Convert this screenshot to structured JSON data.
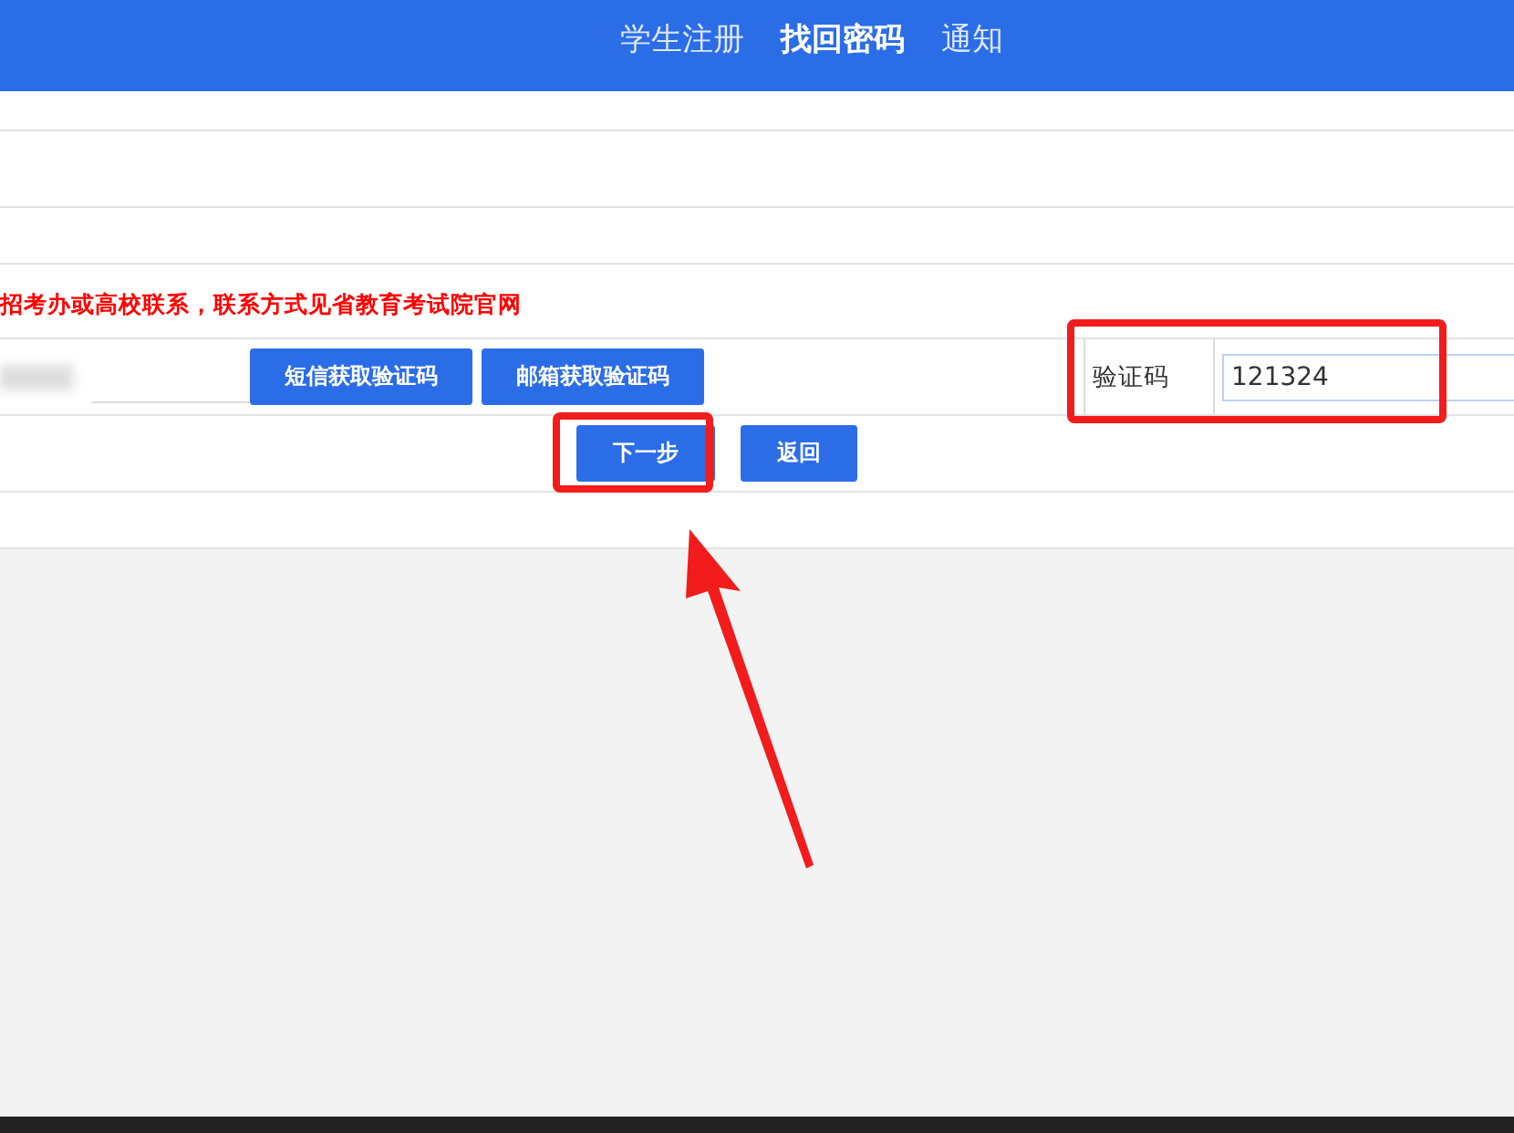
{
  "tabs": [
    {
      "label": "学生注册",
      "selected": false
    },
    {
      "label": "找回密码",
      "selected": true
    },
    {
      "label": "通知",
      "selected": false
    }
  ],
  "notice": "招考办或高校联系，联系方式见省教育考试院官网",
  "code_buttons": [
    {
      "label": "短信获取验证码"
    },
    {
      "label": "邮箱获取验证码"
    }
  ],
  "verification": {
    "label": "验证码",
    "value": "121324",
    "highlighted": true
  },
  "actions": [
    {
      "label": "下一步",
      "highlighted": true
    },
    {
      "label": "返回",
      "highlighted": false
    }
  ],
  "annotation_arrow": true
}
